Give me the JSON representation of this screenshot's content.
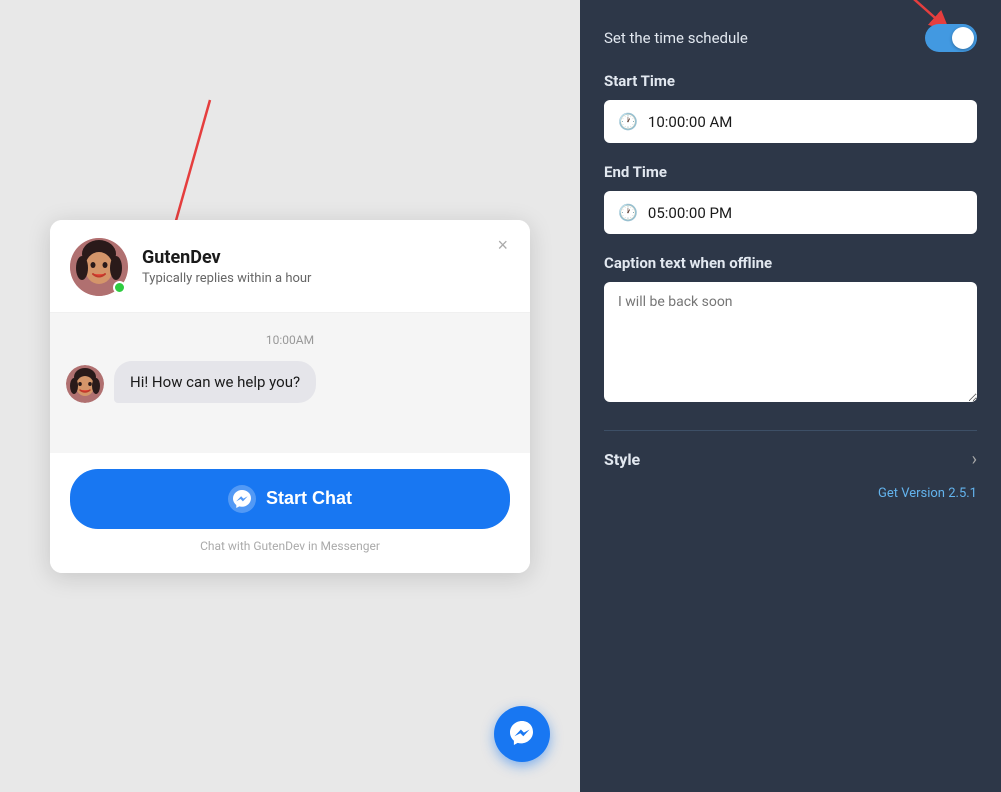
{
  "left": {
    "agent": {
      "name": "GutenDev",
      "status": "Typically replies within a hour",
      "online": true
    },
    "chat": {
      "timestamp": "10:00AM",
      "message": "Hi! How can we help you?"
    },
    "footer": {
      "start_chat_label": "Start Chat",
      "tagline": "Chat with GutenDev in Messenger"
    },
    "close_btn": "×"
  },
  "right": {
    "schedule": {
      "label": "Set the time schedule",
      "toggle_on": true
    },
    "start_time": {
      "label": "Start Time",
      "value": "10:00:00 AM"
    },
    "end_time": {
      "label": "End Time",
      "value": "05:00:00 PM"
    },
    "caption": {
      "label": "Caption text when offline",
      "placeholder": "I will be back soon"
    },
    "style": {
      "label": "Style"
    },
    "bottom_link": "Get Version 2.5.1"
  },
  "icons": {
    "clock": "🕐",
    "chevron_right": "›",
    "close": "×"
  }
}
